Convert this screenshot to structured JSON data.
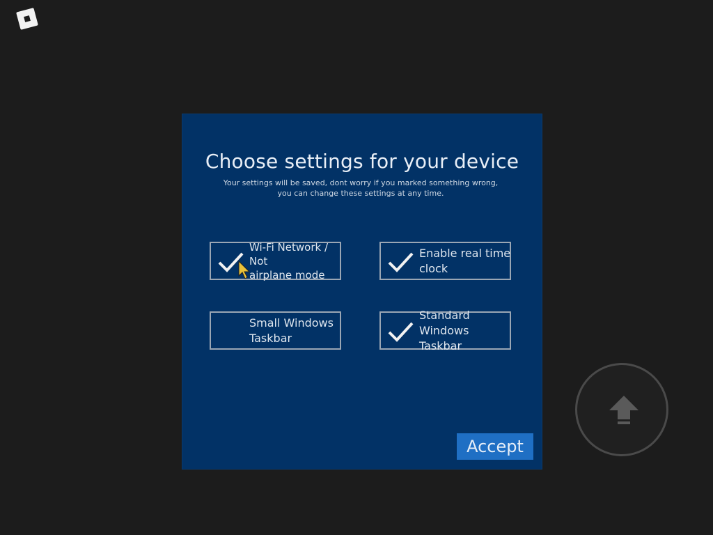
{
  "dialog": {
    "title": "Choose settings for your device",
    "subtitle": "Your settings will be saved, dont worry if you marked something wrong, you can change these settings at any time.",
    "options": [
      {
        "label": "Wi-Fi Network / Not\nairplane mode",
        "checked": true
      },
      {
        "label": "Enable real time\nclock",
        "checked": true
      },
      {
        "label": "Small Windows\nTaskbar",
        "checked": false
      },
      {
        "label": "Standard\nWindows Taskbar",
        "checked": true
      }
    ],
    "accept_label": "Accept"
  },
  "icons": {
    "logo": "roblox-logo-icon",
    "check": "checkmark-icon",
    "jump": "jump-arrow-up-icon",
    "cursor": "mouse-pointer-icon"
  },
  "colors": {
    "background": "#1c1c1c",
    "dialog": "#023266",
    "accept": "#1f6fc4",
    "border": "#9aa6b4"
  }
}
